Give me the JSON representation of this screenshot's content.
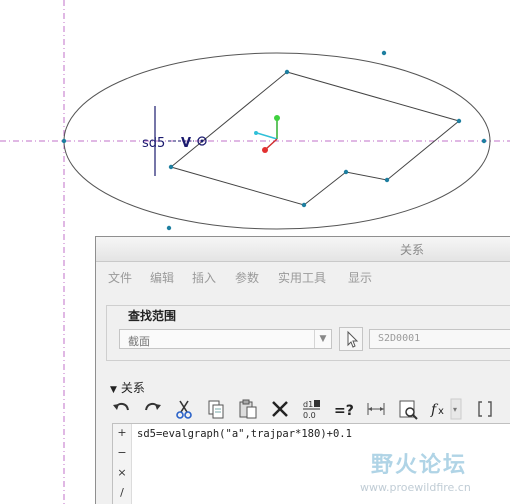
{
  "sketch": {
    "dimension_label": "sd5",
    "constraint_label": "V"
  },
  "dialog": {
    "title": "关系",
    "menu": [
      "文件",
      "编辑",
      "插入",
      "参数",
      "实用工具",
      "显示"
    ],
    "search": {
      "group_label": "查找范围",
      "type_value": "截面",
      "name_value": "S2D0001"
    },
    "relations": {
      "header": "关系",
      "toolbar_icons": [
        "undo-icon",
        "redo-icon",
        "cut-icon",
        "copy-icon",
        "paste-icon",
        "delete-icon",
        "switch-dims-icon",
        "verify-icon",
        "ruler-icon",
        "sort-icon",
        "function-icon",
        "bracket-icon"
      ],
      "gutter": [
        "+",
        "−",
        "×",
        "/"
      ],
      "lines": [
        "sd5=evalgraph(\"a\",trajpar*180)+0.1"
      ]
    }
  },
  "watermark": {
    "text": "野火论坛",
    "url": "www.proewildfire.cn"
  }
}
